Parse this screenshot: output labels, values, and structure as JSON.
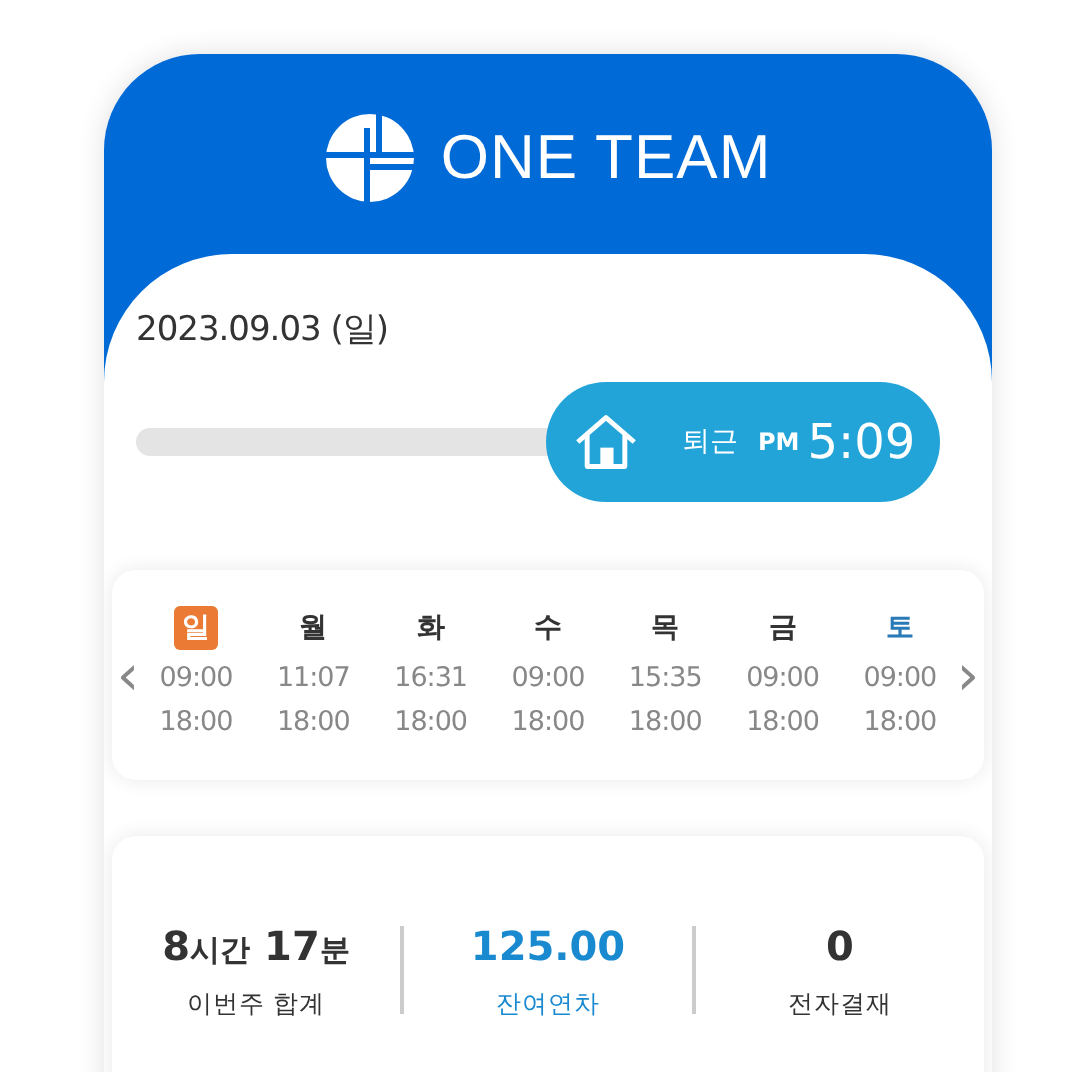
{
  "header": {
    "logo_text": "ONE TEAM"
  },
  "date": "2023.09.03 (일)",
  "clock_out": {
    "label": "퇴근",
    "meridiem": "PM",
    "time": "5:09"
  },
  "week": {
    "prev": "‹",
    "next": "›",
    "days": [
      {
        "day": "일",
        "selected": true,
        "start": "09:00",
        "end": "18:00"
      },
      {
        "day": "월",
        "selected": false,
        "kind": "weekday",
        "start": "11:07",
        "end": "18:00"
      },
      {
        "day": "화",
        "selected": false,
        "kind": "weekday",
        "start": "16:31",
        "end": "18:00"
      },
      {
        "day": "수",
        "selected": false,
        "kind": "weekday",
        "start": "09:00",
        "end": "18:00"
      },
      {
        "day": "목",
        "selected": false,
        "kind": "weekday",
        "start": "15:35",
        "end": "18:00"
      },
      {
        "day": "금",
        "selected": false,
        "kind": "weekday",
        "start": "09:00",
        "end": "18:00"
      },
      {
        "day": "토",
        "selected": false,
        "kind": "saturday",
        "start": "09:00",
        "end": "18:00"
      }
    ]
  },
  "stats": [
    {
      "parts": [
        {
          "kind": "number",
          "text": "8"
        },
        {
          "kind": "unit",
          "text": "시간"
        },
        {
          "kind": "number",
          "text": " 17"
        },
        {
          "kind": "unit",
          "text": "분"
        }
      ],
      "label": "이번주 합계",
      "color": "#333333"
    },
    {
      "parts": [
        {
          "kind": "number",
          "text": "125.00"
        }
      ],
      "label": "잔여연차",
      "color": "#1a8ad0"
    },
    {
      "parts": [
        {
          "kind": "number",
          "text": "0"
        }
      ],
      "label": "전자결재",
      "color": "#333333"
    }
  ]
}
